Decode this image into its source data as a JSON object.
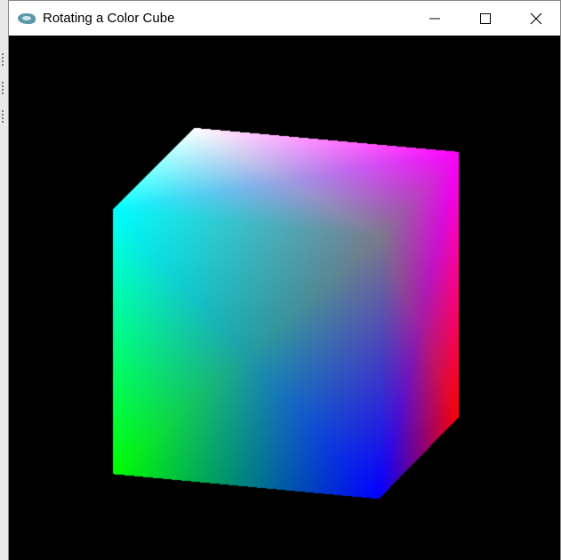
{
  "window": {
    "title": "Rotating a Color Cube",
    "icon": "app-icon",
    "controls": [
      "minimize-icon",
      "maximize-icon",
      "close-icon"
    ]
  },
  "scene": {
    "background": "#000000",
    "vertex_colors": {
      "top_back": "#ffffff",
      "top_right": "#ff00ff",
      "bottom_right_back": "#ff0000",
      "bottom_front": "#0000ff",
      "bottom_left": "#00ff00",
      "top_left": "#00ffff"
    }
  }
}
